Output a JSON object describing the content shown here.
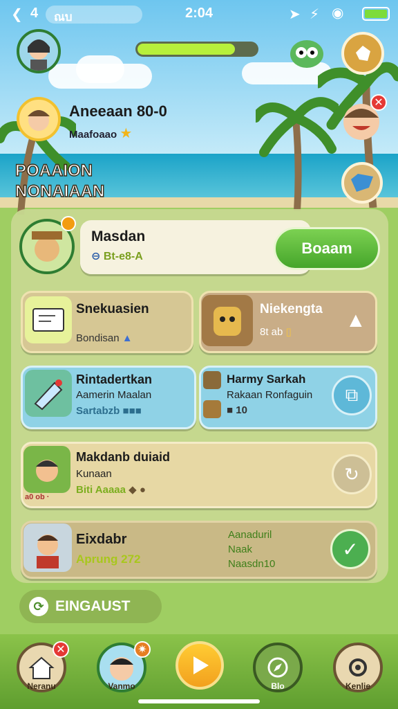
{
  "status": {
    "back_num": "4",
    "carrier": "ณบ",
    "time": "2:04"
  },
  "header": {
    "xp_progress": 0.82
  },
  "profile": {
    "name": "Aneeaan 80-0",
    "subtitle": "Maafoaao"
  },
  "section_title": {
    "line1": "POAAION",
    "line2": "NONAIAAN"
  },
  "featured": {
    "name": "Masdan",
    "tag": "Bt-e8-A",
    "action_label": "Boaam"
  },
  "cards": [
    {
      "title": "Snekuasien",
      "sub": "Bondisan"
    },
    {
      "title": "Niekengta",
      "sub": "8t ab"
    },
    {
      "title": "Rintadertkan",
      "line2": "Aamerin Maalan",
      "line3": "Sartabzb"
    },
    {
      "title": "Harmy Sarkah",
      "line2": "Rakaan Ronfaguin",
      "line3": "10"
    },
    {
      "title": "Makdanb duiaid",
      "line2": "Kunaan",
      "line3": "Biti Aaaaa",
      "tiny": "a0 ob ·"
    },
    {
      "title": "Eixdabr",
      "line2": "Aprung 272",
      "right1": "Aanaduril",
      "right2": "Naak",
      "right3": "Naasdn10"
    }
  ],
  "engage_label": "EINGAUST",
  "nav": [
    {
      "label": "Neranu",
      "icon": "home-icon"
    },
    {
      "label": "Vanmo",
      "icon": "avatar-icon"
    },
    {
      "label": "",
      "icon": "play-icon"
    },
    {
      "label": "Blo",
      "icon": "compass-icon"
    },
    {
      "label": "Kenlie",
      "icon": "settings-icon"
    }
  ]
}
